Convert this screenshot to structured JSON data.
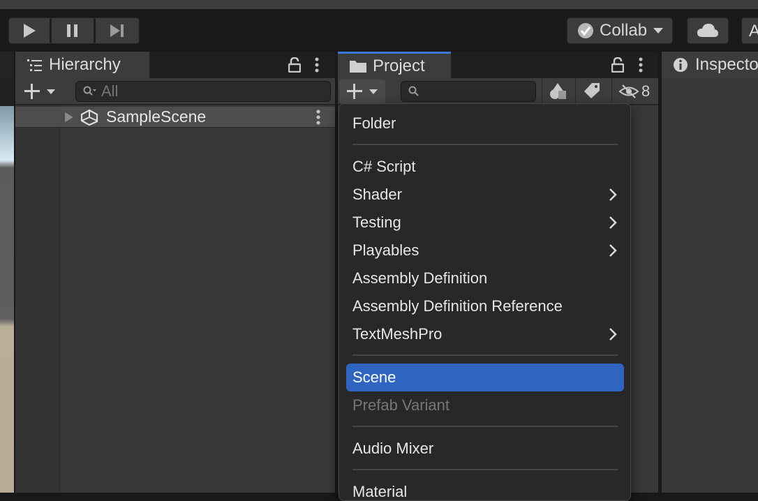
{
  "toolbar": {
    "collab_label": "Collab",
    "account_label": "A"
  },
  "hierarchy": {
    "tab_label": "Hierarchy",
    "search_placeholder": "All",
    "scene_name": "SampleScene"
  },
  "project": {
    "tab_label": "Project",
    "hidden_count": "8"
  },
  "inspector": {
    "tab_label": "Inspector"
  },
  "menu": {
    "items": [
      {
        "label": "Folder"
      },
      {
        "label": "C# Script"
      },
      {
        "label": "Shader",
        "submenu": true
      },
      {
        "label": "Testing",
        "submenu": true
      },
      {
        "label": "Playables",
        "submenu": true
      },
      {
        "label": "Assembly Definition"
      },
      {
        "label": "Assembly Definition Reference"
      },
      {
        "label": "TextMeshPro",
        "submenu": true
      },
      {
        "label": "Scene",
        "selected": true
      },
      {
        "label": "Prefab Variant",
        "disabled": true
      },
      {
        "label": "Audio Mixer"
      },
      {
        "label": "Material"
      }
    ]
  },
  "colors": {
    "selection": "#2f65c0",
    "active_tab_accent": "#3a79d9",
    "panel_bg": "#383838"
  }
}
